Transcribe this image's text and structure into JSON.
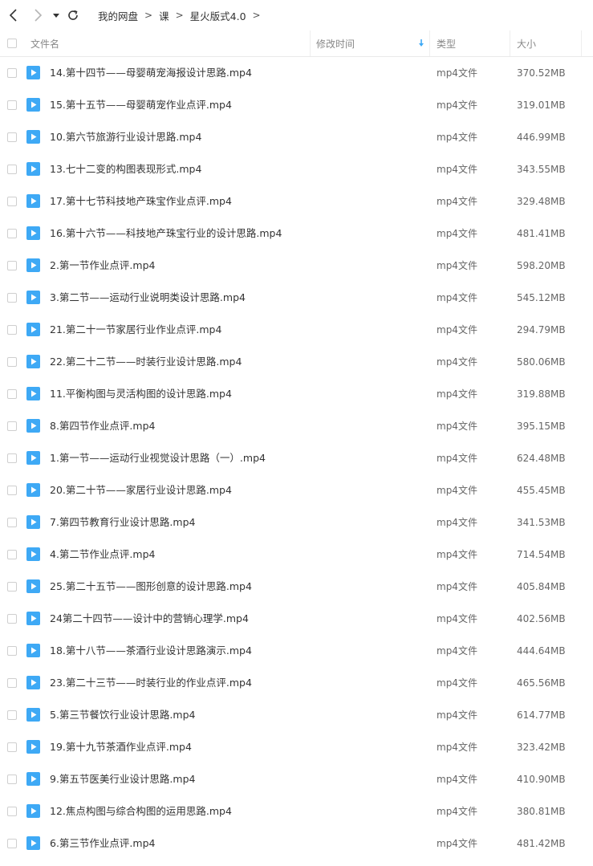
{
  "breadcrumb": [
    "我的网盘",
    "课",
    "星火版式4.0"
  ],
  "columns": {
    "name": "文件名",
    "modified": "修改时间",
    "type": "类型",
    "size": "大小"
  },
  "accent_color": "#3ea9f5",
  "files": [
    {
      "name": "14.第十四节——母婴萌宠海报设计思路.mp4",
      "type": "mp4文件",
      "size": "370.52MB"
    },
    {
      "name": "15.第十五节——母婴萌宠作业点评.mp4",
      "type": "mp4文件",
      "size": "319.01MB"
    },
    {
      "name": "10.第六节旅游行业设计思路.mp4",
      "type": "mp4文件",
      "size": "446.99MB"
    },
    {
      "name": "13.七十二变的构图表现形式.mp4",
      "type": "mp4文件",
      "size": "343.55MB"
    },
    {
      "name": "17.第十七节科技地产珠宝作业点评.mp4",
      "type": "mp4文件",
      "size": "329.48MB"
    },
    {
      "name": "16.第十六节——科技地产珠宝行业的设计思路.mp4",
      "type": "mp4文件",
      "size": "481.41MB"
    },
    {
      "name": "2.第一节作业点评.mp4",
      "type": "mp4文件",
      "size": "598.20MB"
    },
    {
      "name": "3.第二节——运动行业说明类设计思路.mp4",
      "type": "mp4文件",
      "size": "545.12MB"
    },
    {
      "name": "21.第二十一节家居行业作业点评.mp4",
      "type": "mp4文件",
      "size": "294.79MB"
    },
    {
      "name": "22.第二十二节——时装行业设计思路.mp4",
      "type": "mp4文件",
      "size": "580.06MB"
    },
    {
      "name": "11.平衡构图与灵活构图的设计思路.mp4",
      "type": "mp4文件",
      "size": "319.88MB"
    },
    {
      "name": "8.第四节作业点评.mp4",
      "type": "mp4文件",
      "size": "395.15MB"
    },
    {
      "name": "1.第一节——运动行业视觉设计思路（一）.mp4",
      "type": "mp4文件",
      "size": "624.48MB"
    },
    {
      "name": "20.第二十节——家居行业设计思路.mp4",
      "type": "mp4文件",
      "size": "455.45MB"
    },
    {
      "name": "7.第四节教育行业设计思路.mp4",
      "type": "mp4文件",
      "size": "341.53MB"
    },
    {
      "name": "4.第二节作业点评.mp4",
      "type": "mp4文件",
      "size": "714.54MB"
    },
    {
      "name": "25.第二十五节——图形创意的设计思路.mp4",
      "type": "mp4文件",
      "size": "405.84MB"
    },
    {
      "name": "24第二十四节——设计中的营销心理学.mp4",
      "type": "mp4文件",
      "size": "402.56MB"
    },
    {
      "name": "18.第十八节——茶酒行业设计思路演示.mp4",
      "type": "mp4文件",
      "size": "444.64MB"
    },
    {
      "name": "23.第二十三节——时装行业的作业点评.mp4",
      "type": "mp4文件",
      "size": "465.56MB"
    },
    {
      "name": "5.第三节餐饮行业设计思路.mp4",
      "type": "mp4文件",
      "size": "614.77MB"
    },
    {
      "name": "19.第十九节茶酒作业点评.mp4",
      "type": "mp4文件",
      "size": "323.42MB"
    },
    {
      "name": "9.第五节医美行业设计思路.mp4",
      "type": "mp4文件",
      "size": "410.90MB"
    },
    {
      "name": "12.焦点构图与综合构图的运用思路.mp4",
      "type": "mp4文件",
      "size": "380.81MB"
    },
    {
      "name": "6.第三节作业点评.mp4",
      "type": "mp4文件",
      "size": "481.42MB"
    }
  ]
}
